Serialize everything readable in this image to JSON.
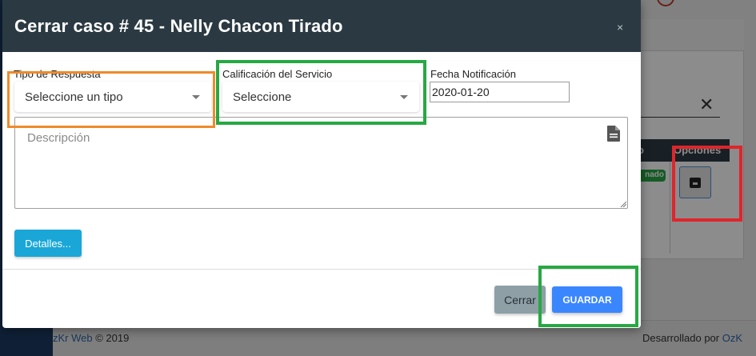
{
  "background": {
    "table_header_prev_partial": "o",
    "table_header_options": "Opciones",
    "status_badge_partial": "nado",
    "footer": {
      "left_link": "zKr Web",
      "left_text": " © 2019",
      "right_text": "Desarrollado por ",
      "right_link": "OzK"
    },
    "close_symbol": "✕"
  },
  "modal": {
    "title": "Cerrar caso # 45 - Nelly Chacon Tirado",
    "close_symbol": "×",
    "fields": {
      "tipo_respuesta": {
        "label": "Tipo de Respuesta",
        "selected": "Seleccione un tipo"
      },
      "calificacion": {
        "label": "Calificación del Servicio",
        "selected": "Seleccione"
      },
      "fecha": {
        "label": "Fecha Notificación",
        "value": "2020-01-20"
      },
      "descripcion": {
        "placeholder": "Descripción",
        "value": ""
      }
    },
    "buttons": {
      "detalles": "Detalles...",
      "cerrar": "Cerrar",
      "guardar": "GUARDAR"
    }
  },
  "colors": {
    "header_bg": "#2b3a42",
    "detalles_btn": "#1aa7d8",
    "cerrar_btn": "#8e9fa6",
    "guardar_btn": "#3a86ff",
    "highlight_orange": "#f08a2b",
    "highlight_green": "#27a843",
    "highlight_red": "#e0252b"
  },
  "icons": {
    "textarea_icon": "document-icon",
    "select_caret": "caret-down-icon",
    "options_button": "archive-icon"
  }
}
